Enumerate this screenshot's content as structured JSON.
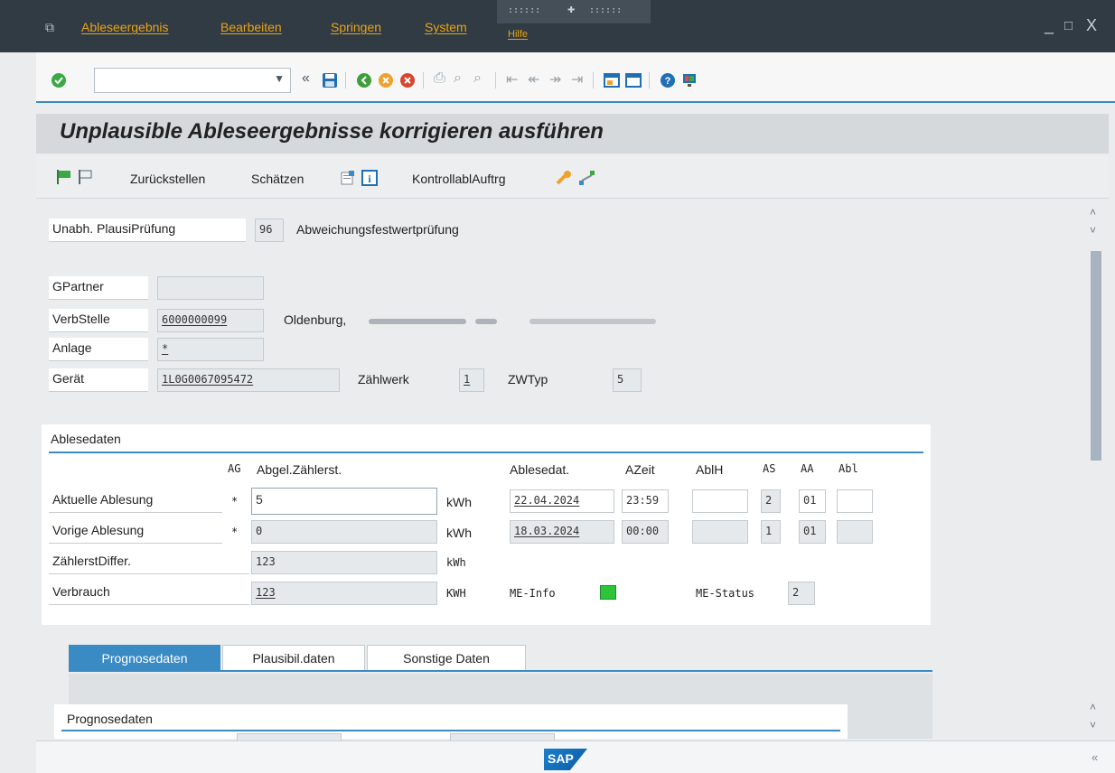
{
  "menubar": {
    "items": [
      "Ableseergebnis",
      "Bearbeiten",
      "Springen",
      "System",
      "Hilfe"
    ],
    "window_controls": [
      "_",
      "□",
      "X"
    ]
  },
  "title": "Unplausible Ableseergebnisse korrigieren ausführen",
  "app_toolbar": {
    "reset_label": "Zurückstellen",
    "estimate_label": "Schätzen",
    "control_order_label": "KontrollablAuftrg"
  },
  "header": {
    "plaus_label": "Unabh. PlausiPrüfung",
    "plaus_code": "96",
    "plaus_desc": "Abweichungsfestwertprüfung"
  },
  "object": {
    "gpartner_label": "GPartner",
    "gpartner_value": "",
    "verbstelle_label": "VerbStelle",
    "verbstelle_value": "6000000099",
    "verbstelle_city": "Oldenburg,",
    "anlage_label": "Anlage",
    "anlage_value": "*",
    "geraet_label": "Gerät",
    "geraet_value": "1L0G0067095472",
    "zaehlwerk_label": "Zählwerk",
    "zaehlwerk_value": "1",
    "zwtyp_label": "ZWTyp",
    "zwtyp_value": "5"
  },
  "ablesedaten": {
    "group_title": "Ablesedaten",
    "columns": [
      "AG",
      "Abgel.Zählerst.",
      "Ablesedat.",
      "AZeit",
      "AblH",
      "AS",
      "AA",
      "Abl"
    ],
    "rows": [
      {
        "label": "Aktuelle Ablesung",
        "ag": "*",
        "value": "5",
        "unit": "kWh",
        "date": "22.04.2024",
        "time": "23:59",
        "ablh": "",
        "as": "2",
        "aa": "01",
        "abl": ""
      },
      {
        "label": "Vorige Ablesung",
        "ag": "*",
        "value": "0",
        "unit": "kWh",
        "date": "18.03.2024",
        "time": "00:00",
        "ablh": "",
        "as": "1",
        "aa": "01",
        "abl": ""
      }
    ],
    "diff_label": "ZählerstDiffer.",
    "diff_value": "123",
    "diff_unit": "kWh",
    "verbrauch_label": "Verbrauch",
    "verbrauch_value": "123",
    "verbrauch_unit": "KWH",
    "meinfo_label": "ME-Info",
    "meinfo_color": "#2ec43a",
    "mestatus_label": "ME-Status",
    "mestatus_value": "2"
  },
  "tabs": [
    "Prognosedaten",
    "Plausibil.daten",
    "Sonstige Daten"
  ],
  "prognose": {
    "group_title": "Prognosedaten"
  },
  "footer": {
    "logo": "SAP"
  },
  "colors": {
    "accent": "#3a8bc4",
    "menubar": "#313b44",
    "menu_text": "#e8a317"
  }
}
